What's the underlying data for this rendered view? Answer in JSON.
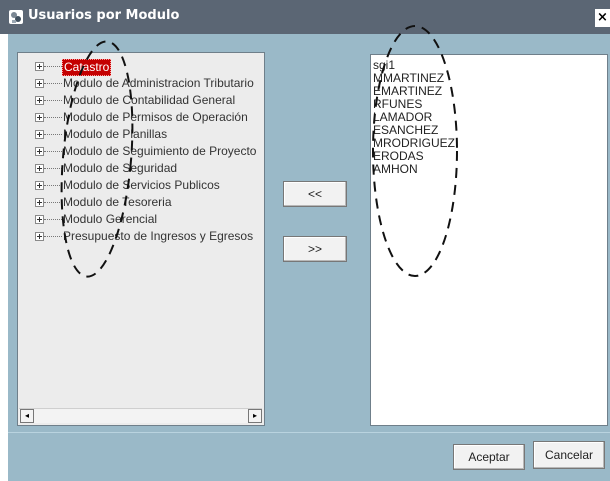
{
  "window": {
    "title": "Usuarios por Modulo"
  },
  "tree": {
    "items": [
      {
        "label": "Catastro",
        "selected": true
      },
      {
        "label": "Modulo de Administracion Tributario"
      },
      {
        "label": "Modulo de Contabilidad General"
      },
      {
        "label": "Modulo de Permisos de Operación"
      },
      {
        "label": "Modulo de Planillas"
      },
      {
        "label": "Modulo de Seguimiento de Proyecto"
      },
      {
        "label": "Modulo de Seguridad"
      },
      {
        "label": "Modulo de Servicios Publicos"
      },
      {
        "label": "Modulo de Tesoreria"
      },
      {
        "label": "Modulo Gerencial"
      },
      {
        "label": "Presupuesto de Ingresos y Egresos"
      }
    ]
  },
  "transfer": {
    "left_label": "<<",
    "right_label": ">>"
  },
  "users": {
    "items": [
      "sgi1",
      "MMARTINEZ",
      "EMARTINEZ",
      "RFUNES",
      "LAMADOR",
      "ESANCHEZ",
      "MRODRIGUEZ",
      "ERODAS",
      "AMHON"
    ]
  },
  "footer": {
    "accept_label": "Aceptar",
    "cancel_label": "Cancelar"
  },
  "colors": {
    "titlebar": "#5b6674",
    "background": "#9ab9c8",
    "selection": "#c40000"
  }
}
